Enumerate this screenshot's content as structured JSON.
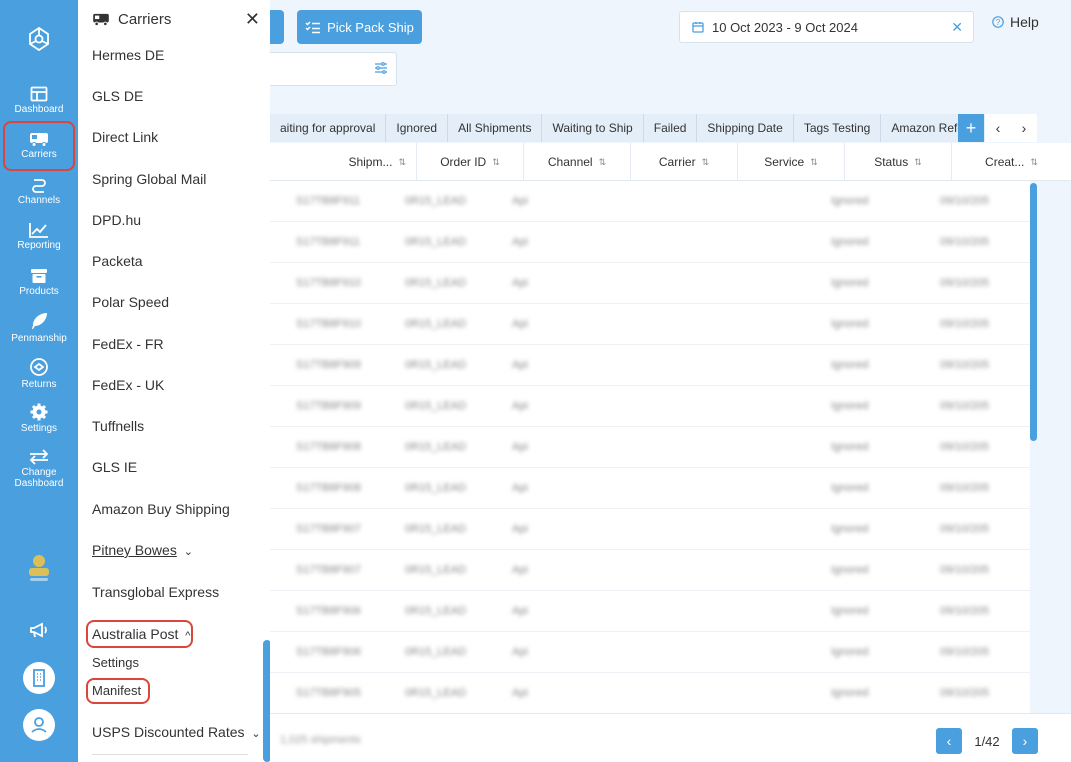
{
  "rail": {
    "items": [
      {
        "label": "Dashboard"
      },
      {
        "label": "Carriers"
      },
      {
        "label": "Channels"
      },
      {
        "label": "Reporting"
      },
      {
        "label": "Products"
      },
      {
        "label": "Penmanship"
      },
      {
        "label": "Returns"
      },
      {
        "label": "Settings"
      },
      {
        "label": "Change Dashboard"
      }
    ]
  },
  "panel": {
    "title": "Carriers",
    "items": [
      {
        "label": "Hermes DE"
      },
      {
        "label": "GLS DE"
      },
      {
        "label": "Direct Link"
      },
      {
        "label": "Spring Global Mail"
      },
      {
        "label": "DPD.hu"
      },
      {
        "label": "Packeta"
      },
      {
        "label": "Polar Speed"
      },
      {
        "label": "FedEx - FR"
      },
      {
        "label": "FedEx - UK"
      },
      {
        "label": "Tuffnells"
      },
      {
        "label": "GLS IE"
      },
      {
        "label": "Amazon Buy Shipping"
      },
      {
        "label": "Pitney Bowes"
      },
      {
        "label": "Transglobal Express"
      },
      {
        "label": "Australia Post"
      },
      {
        "label": "Settings"
      },
      {
        "label": "Manifest"
      },
      {
        "label": "USPS Discounted Rates"
      }
    ]
  },
  "toolbar": {
    "pick_pack_ship": "Pick Pack Ship",
    "date_range": "10 Oct 2023 - 9 Oct 2024",
    "help": "Help"
  },
  "tabs": [
    {
      "label": "aiting for approval"
    },
    {
      "label": "Ignored"
    },
    {
      "label": "All Shipments"
    },
    {
      "label": "Waiting to Ship"
    },
    {
      "label": "Failed"
    },
    {
      "label": "Shipping Date"
    },
    {
      "label": "Tags Testing"
    },
    {
      "label": "Amazon Referen"
    }
  ],
  "table": {
    "columns": [
      "Shipm...",
      "Order ID",
      "Channel",
      "Carrier",
      "Service",
      "Status",
      "Creat..."
    ],
    "rows": [
      [
        "S17TB8F911",
        "0R15_LEAD",
        "Api",
        "Ignored",
        "09/10/205"
      ],
      [
        "S17TB8F911",
        "0R15_LEAD",
        "Api",
        "Ignored",
        "09/10/205"
      ],
      [
        "S17TB8F910",
        "0R15_LEAD",
        "Api",
        "Ignored",
        "09/10/205"
      ],
      [
        "S17TB8F910",
        "0R15_LEAD",
        "Api",
        "Ignored",
        "09/10/205"
      ],
      [
        "S17TB8F909",
        "0R15_LEAD",
        "Api",
        "Ignored",
        "09/10/205"
      ],
      [
        "S17TB8F909",
        "0R15_LEAD",
        "Api",
        "Ignored",
        "09/10/205"
      ],
      [
        "S17TB8F908",
        "0R15_LEAD",
        "Api",
        "Ignored",
        "09/10/205"
      ],
      [
        "S17TB8F908",
        "0R15_LEAD",
        "Api",
        "Ignored",
        "09/10/205"
      ],
      [
        "S17TB8F907",
        "0R15_LEAD",
        "Api",
        "Ignored",
        "09/10/205"
      ],
      [
        "S17TB8F907",
        "0R15_LEAD",
        "Api",
        "Ignored",
        "09/10/205"
      ],
      [
        "S17TB8F906",
        "0R15_LEAD",
        "Api",
        "Ignored",
        "09/10/205"
      ],
      [
        "S17TB8F906",
        "0R15_LEAD",
        "Api",
        "Ignored",
        "09/10/205"
      ],
      [
        "S17TB8F905",
        "0R15_LEAD",
        "Api",
        "Ignored",
        "09/10/205"
      ]
    ]
  },
  "footer": {
    "count": "1,025 shipments",
    "page": "1/42"
  },
  "colors": {
    "accent": "#4a9fdf",
    "highlight": "#d9463c"
  }
}
